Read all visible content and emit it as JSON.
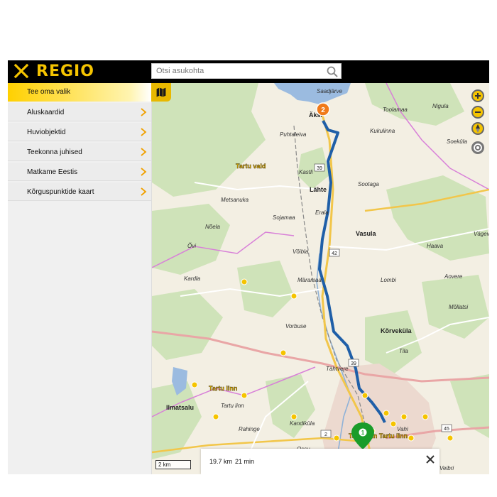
{
  "header": {
    "brand": "REGIO",
    "search_placeholder": "Otsi asukohta"
  },
  "sidebar": {
    "head_label": "Tee oma valik",
    "items": [
      {
        "label": "Aluskaardid"
      },
      {
        "label": "Huviobjektid"
      },
      {
        "label": "Teekonna juhised"
      },
      {
        "label": "Matkame Eestis"
      },
      {
        "label": "Kõrguspunktide kaart"
      }
    ]
  },
  "map": {
    "place_labels": [
      {
        "text": "Saadjärve"
      },
      {
        "text": "Äksi"
      },
      {
        "text": "Toolamaa"
      },
      {
        "text": "Nigula"
      },
      {
        "text": "Puhtaleiva"
      },
      {
        "text": "Kukulinna"
      },
      {
        "text": "Soeküla"
      },
      {
        "text": "Tartu vald"
      },
      {
        "text": "Kastli"
      },
      {
        "text": "Lähte"
      },
      {
        "text": "Sootaga"
      },
      {
        "text": "Metsanuka"
      },
      {
        "text": "Erala"
      },
      {
        "text": "Sojamaa"
      },
      {
        "text": "Vasula"
      },
      {
        "text": "Nõela"
      },
      {
        "text": "Õvi"
      },
      {
        "text": "Võibla"
      },
      {
        "text": "Haava"
      },
      {
        "text": "Vägeva"
      },
      {
        "text": "Kardla"
      },
      {
        "text": "Märamaa"
      },
      {
        "text": "Lombi"
      },
      {
        "text": "Aovere"
      },
      {
        "text": "Mõllatsi"
      },
      {
        "text": "Vorbuse"
      },
      {
        "text": "Kõrveküla"
      },
      {
        "text": "Tila"
      },
      {
        "text": "Tähtvere"
      },
      {
        "text": "Tartu linn"
      },
      {
        "text": "Ilmatsalu"
      },
      {
        "text": "Tartu linn"
      },
      {
        "text": "Rahinge"
      },
      {
        "text": "Kandiküla"
      },
      {
        "text": "Tartu linn Tartu linn"
      },
      {
        "text": "Ossu"
      },
      {
        "text": "Märja"
      },
      {
        "text": "Veibri"
      },
      {
        "text": "Vahi"
      }
    ],
    "road_numbers": [
      "39",
      "42",
      "39",
      "45",
      "2"
    ],
    "markers": [
      {
        "label": "1",
        "color": "#1a9c2a"
      },
      {
        "label": "2",
        "color": "#f07a1a"
      }
    ],
    "scale_label": "2 km",
    "route_color": "#1f5fa8"
  },
  "route_info": {
    "distance": "19.7 km",
    "duration": "21 min"
  },
  "colors": {
    "brand_yellow": "#f5c400",
    "topbar": "#000000"
  }
}
